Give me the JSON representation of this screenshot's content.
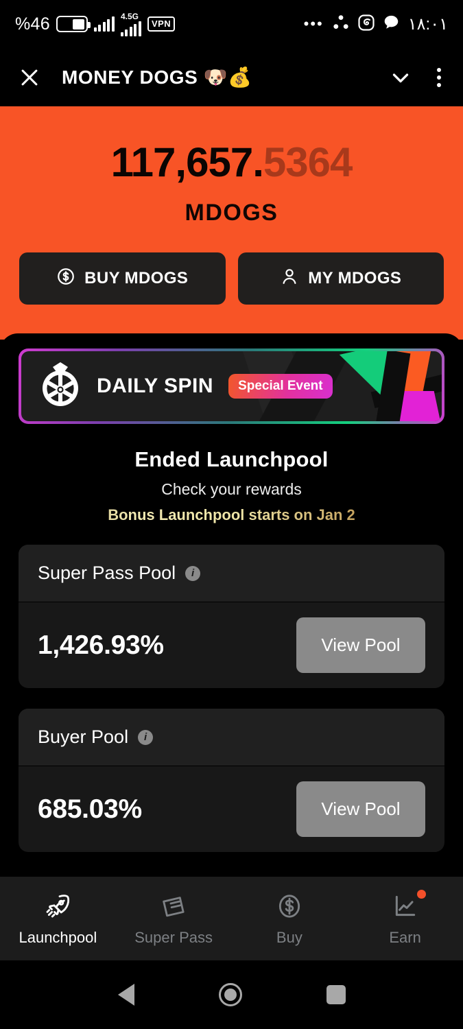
{
  "status_bar": {
    "battery_percent": "%46",
    "network_label": "4.5G",
    "vpn_label": "VPN",
    "overflow_dots": "•••",
    "time": "١٨:٠١"
  },
  "header": {
    "title": "MONEY DOGS 🐶💰",
    "close_icon": "close-icon",
    "collapse_icon": "chevron-down-icon",
    "menu_icon": "kebab-menu-icon"
  },
  "hero": {
    "balance_whole": "117,657.",
    "balance_decimals": "5364",
    "ticker": "MDOGS",
    "accent_color": "#f85426",
    "buttons": [
      {
        "label": "BUY MDOGS",
        "icon": "dollar-circle-icon"
      },
      {
        "label": "MY MDOGS",
        "icon": "person-icon"
      }
    ]
  },
  "spin_banner": {
    "title": "DAILY SPIN",
    "badge": "Special Event",
    "icon": "spin-wheel-icon",
    "badge_gradient_from": "#f2572a",
    "badge_gradient_to": "#d930cf"
  },
  "launchpool": {
    "title": "Ended Launchpool",
    "subtitle": "Check your rewards",
    "bonus_note": "Bonus Launchpool starts on Jan 2",
    "pools": [
      {
        "name": "Super Pass Pool",
        "info_icon": "info-icon",
        "value": "1,426.93%",
        "action_label": "View Pool"
      },
      {
        "name": "Buyer Pool",
        "info_icon": "info-icon",
        "value": "685.03%",
        "action_label": "View Pool"
      }
    ]
  },
  "tabbar": {
    "items": [
      {
        "label": "Launchpool",
        "icon": "rocket-icon",
        "active": true,
        "badge": false
      },
      {
        "label": "Super Pass",
        "icon": "ticket-icon",
        "active": false,
        "badge": false
      },
      {
        "label": "Buy",
        "icon": "dollar-circle-icon",
        "active": false,
        "badge": false
      },
      {
        "label": "Earn",
        "icon": "line-chart-icon",
        "active": false,
        "badge": true
      }
    ]
  },
  "system_nav": {
    "back": "back-triangle-icon",
    "home": "home-circle-icon",
    "recents": "recents-square-icon"
  }
}
